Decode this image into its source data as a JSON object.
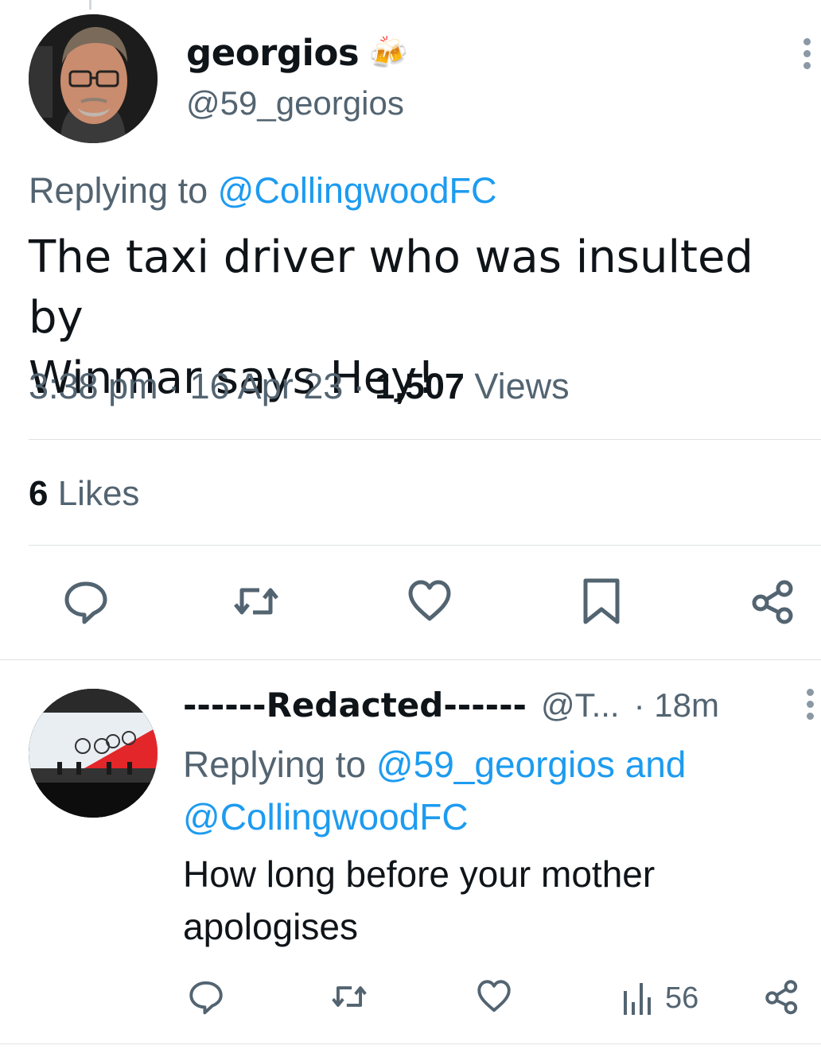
{
  "main_tweet": {
    "display_name": "georgios",
    "emoji": "🍻",
    "handle": "@59_georgios",
    "replying_prefix": "Replying to ",
    "replying_to": "@CollingwoodFC",
    "text_line1": "The taxi driver who was insulted by",
    "text_line2": "Winmar says Hey!",
    "time": "3:38 pm",
    "sep1": " · ",
    "date": "16 Apr 23",
    "sep2": " · ",
    "views_count": "1,507",
    "views_label": " Views",
    "likes_count": "6",
    "likes_label": " Likes",
    "actions": [
      {
        "name": "reply",
        "icon": "speech-bubble-icon"
      },
      {
        "name": "retweet",
        "icon": "retweet-icon"
      },
      {
        "name": "like",
        "icon": "heart-icon"
      },
      {
        "name": "bookmark",
        "icon": "bookmark-icon"
      },
      {
        "name": "share",
        "icon": "share-icon"
      }
    ]
  },
  "reply_tweet": {
    "display_name": "------Redacted------",
    "handle": "@T...",
    "time": "· 18m",
    "replying_prefix": "Replying to ",
    "replying_to_1": "@59_georgios",
    "replying_and": " and",
    "replying_to_2": "@CollingwoodFC",
    "text_line1": "How long before your mother",
    "text_line2": "apologises",
    "views_count": "56",
    "actions": [
      {
        "name": "reply",
        "icon": "speech-bubble-icon"
      },
      {
        "name": "retweet",
        "icon": "retweet-icon"
      },
      {
        "name": "like",
        "icon": "heart-icon"
      },
      {
        "name": "views",
        "icon": "bar-chart-icon"
      },
      {
        "name": "share",
        "icon": "share-icon"
      }
    ]
  },
  "colors": {
    "text": "#0f1419",
    "secondary": "#536471",
    "link": "#1d9bf0",
    "divider": "#dfe3e6",
    "icon": "#536471"
  }
}
